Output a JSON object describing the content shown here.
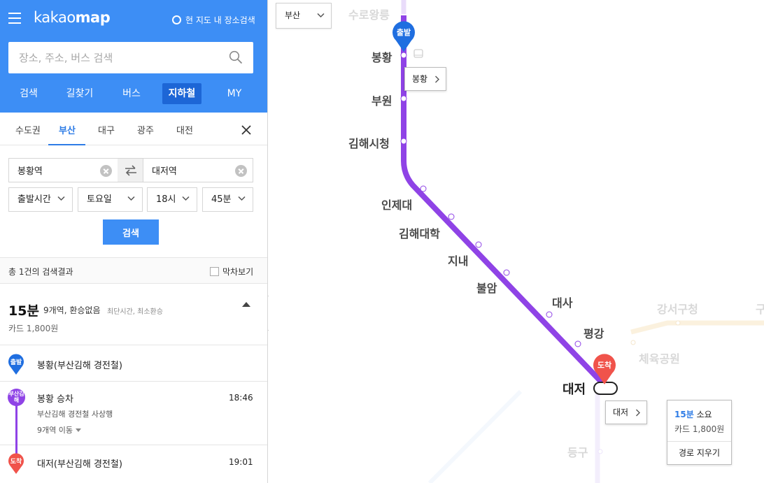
{
  "app": {
    "logo_light": "kakao",
    "logo_bold": "map",
    "view_search_label": "현 지도 내 장소검색",
    "search_placeholder": "장소, 주소, 버스 검색"
  },
  "main_nav": [
    {
      "label": "검색"
    },
    {
      "label": "길찾기"
    },
    {
      "label": "버스"
    },
    {
      "label": "지하철",
      "active": true
    },
    {
      "label": "MY"
    }
  ],
  "city_tabs": [
    {
      "label": "수도권"
    },
    {
      "label": "부산",
      "active": true
    },
    {
      "label": "대구"
    },
    {
      "label": "광주"
    },
    {
      "label": "대전"
    }
  ],
  "route_form": {
    "from_value": "봉황역",
    "to_value": "대저역",
    "time_type": "출발시간",
    "day": "토요일",
    "hour": "18시",
    "minute": "45분",
    "search_button": "검색"
  },
  "results": {
    "count_text": "총 1건의 검색결과",
    "last_train_label": "막차보기",
    "summary": {
      "minutes": "15분",
      "info": "9개역, 환승없음",
      "tags": "최단시간, 최소환승",
      "fare": "카드 1,800원"
    },
    "steps": {
      "start_badge": "출발",
      "start_name": "봉황(부산김해 경전철)",
      "line_badge": "부산김해",
      "board_label": "봉황 승차",
      "board_time": "18:46",
      "direction": "부산김해 경전철 사상행",
      "move_label": "9개역 이동",
      "end_badge": "도착",
      "end_name": "대저(부산김해 경전철)",
      "end_time": "19:01"
    }
  },
  "map": {
    "city_select": "부산",
    "line_color": "#8f43e6",
    "start_pin_label": "출발",
    "end_pin_label": "도착",
    "stations": {
      "suro": "수로왕릉",
      "bonghwang": "봉황",
      "buwon": "부원",
      "gimhae_city": "김해시청",
      "inje": "인제대",
      "gimhae_univ": "김해대학",
      "jinae": "지내",
      "buram": "불암",
      "daesa": "대사",
      "pyeonggang": "평강",
      "daejeo": "대저",
      "sports_park": "체육공원",
      "gangseo_gu": "강서구청",
      "gu_cut": "구",
      "deunggu": "등구"
    },
    "tip_start": "봉황",
    "tip_end": "대저",
    "info_card": {
      "minutes": "15분",
      "suffix": "소요",
      "fare": "카드 1,800원",
      "clear_route": "경로 지우기"
    }
  }
}
